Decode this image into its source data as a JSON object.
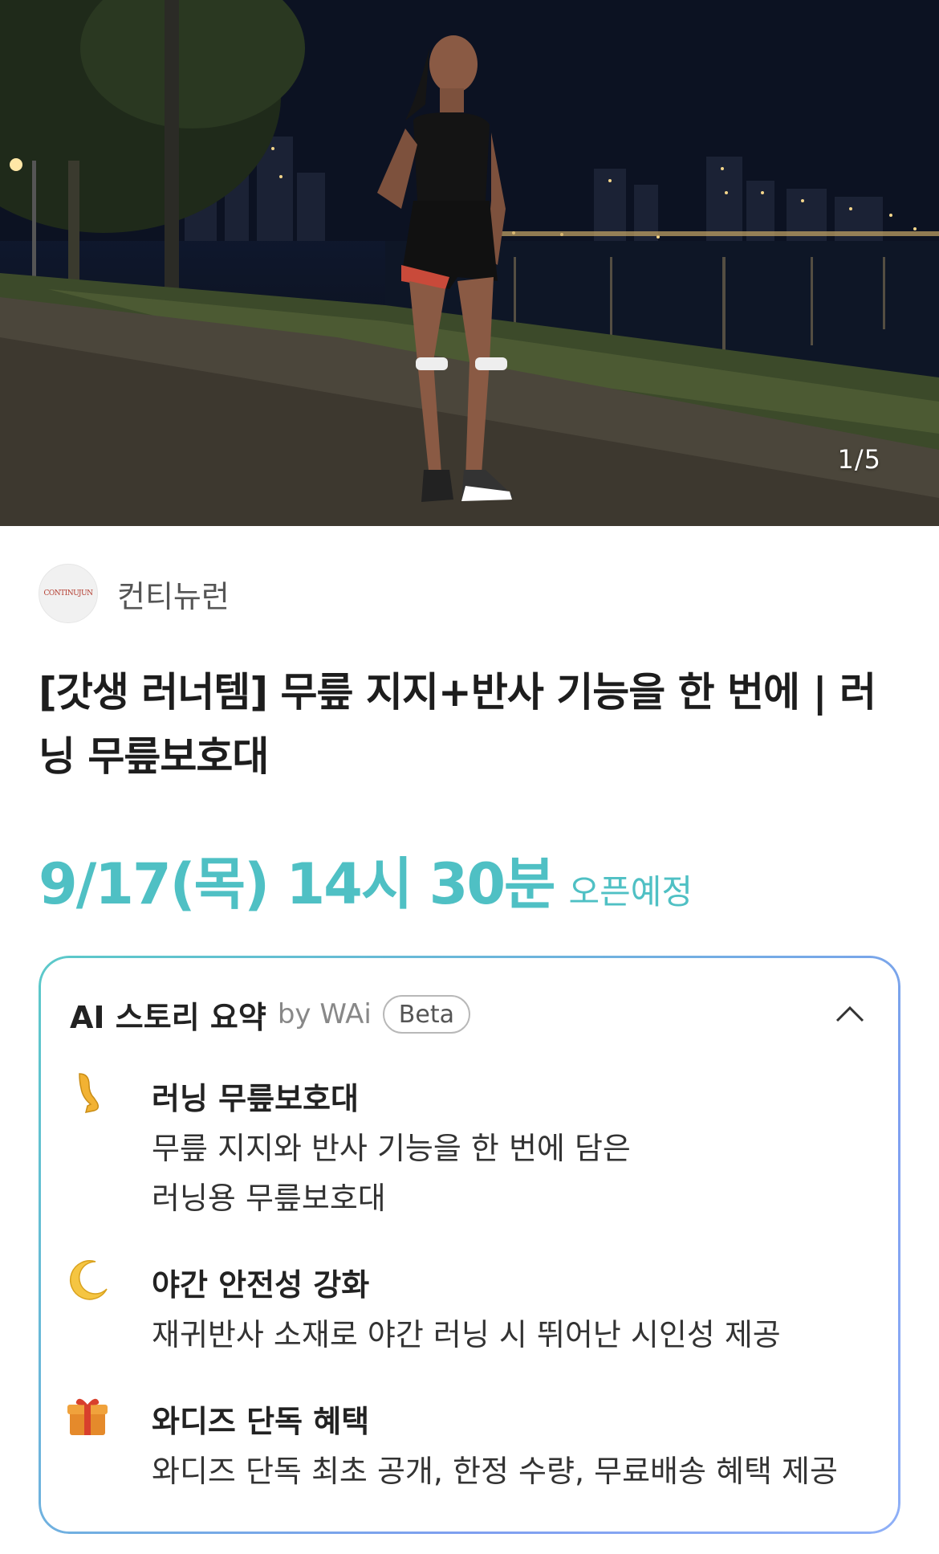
{
  "hero": {
    "counter": "1/5"
  },
  "brand": {
    "logo_text": "CONTINUJUN",
    "name": "컨티뉴런"
  },
  "product": {
    "title": "[갓생 러너템] 무릎 지지+반사 기능을 한 번에 | 러닝 무릎보호대"
  },
  "open": {
    "date": "9/17(목) 14시 30분",
    "label": "오픈예정"
  },
  "ai_summary": {
    "title": "AI 스토리 요약",
    "by": "by WAi",
    "badge": "Beta",
    "items": [
      {
        "icon": "leg-icon",
        "title": "러닝 무릎보호대",
        "desc": "무릎 지지와 반사 기능을 한 번에 담은 러닝용 무릎보호대"
      },
      {
        "icon": "crescent-moon-icon",
        "title": "야간 안전성 강화",
        "desc": "재귀반사 소재로 야간 러닝 시 뛰어난 시인성 제공"
      },
      {
        "icon": "gift-icon",
        "title": "와디즈 단독 혜택",
        "desc": "와디즈 단독 최초 공개, 한정 수량, 무료배송 혜택 제공"
      }
    ]
  },
  "colors": {
    "accent": "#4fc0c4",
    "card_border_start": "#5bc9c9",
    "card_border_end": "#8fb0f7"
  }
}
